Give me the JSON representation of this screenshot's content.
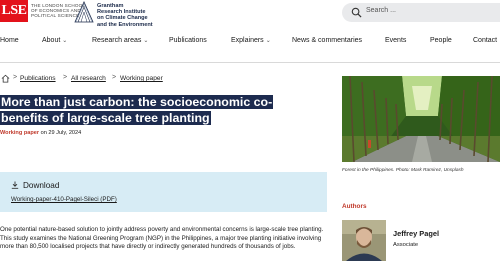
{
  "header": {
    "lse_logo_text": "LSE",
    "lse_name_lines": [
      "THE LONDON SCHOOL",
      "OF ECONOMICS AND",
      "POLITICAL SCIENCE"
    ],
    "institute_lines": [
      "Grantham",
      "Research Institute",
      "on Climate Change",
      "and the Environment"
    ],
    "search_placeholder": "Search ...",
    "search_icon": "search-icon"
  },
  "nav": {
    "items": [
      {
        "label": "Home",
        "has_dropdown": false
      },
      {
        "label": "About",
        "has_dropdown": true
      },
      {
        "label": "Research areas",
        "has_dropdown": true
      },
      {
        "label": "Publications",
        "has_dropdown": false
      },
      {
        "label": "Explainers",
        "has_dropdown": true
      },
      {
        "label": "News & commentaries",
        "has_dropdown": false
      },
      {
        "label": "Events",
        "has_dropdown": false
      },
      {
        "label": "People",
        "has_dropdown": false
      },
      {
        "label": "Contact",
        "has_dropdown": false
      }
    ]
  },
  "breadcrumb": {
    "home_icon": "home-icon",
    "items": [
      "Publications",
      "All research",
      "Working paper"
    ],
    "separator": ">"
  },
  "article": {
    "title_line1": "More than just carbon: the socioeconomic co-",
    "title_line2": "benefits of large-scale tree planting",
    "type": "Working paper",
    "date_text": "on 29 July, 2024",
    "download": {
      "title": "Download",
      "link": "Working-paper-410-Pagel-Sileci (PDF)",
      "icon": "download-icon"
    },
    "summary": "One potential nature-based solution to jointly address poverty and environmental concerns is large-scale tree planting. This study examines the National Greening Program (NGP) in the Philippines, a major tree planting initiative involving more than 80,500 localised projects that have directly or indirectly generated hundreds of thousands of jobs."
  },
  "sidebar": {
    "photo_caption": "Forest in the Philippines. Photo: Mark Ramirez, Unsplash",
    "authors_label": "Authors",
    "author": {
      "name": "Jeffrey Pagel",
      "role": "Associate"
    }
  },
  "colors": {
    "lse_red": "#e3121b",
    "title_highlight": "#1d2b4f",
    "accent_red": "#c0392b",
    "download_bg": "#d7ecf5",
    "search_bg": "#e9eaec"
  }
}
